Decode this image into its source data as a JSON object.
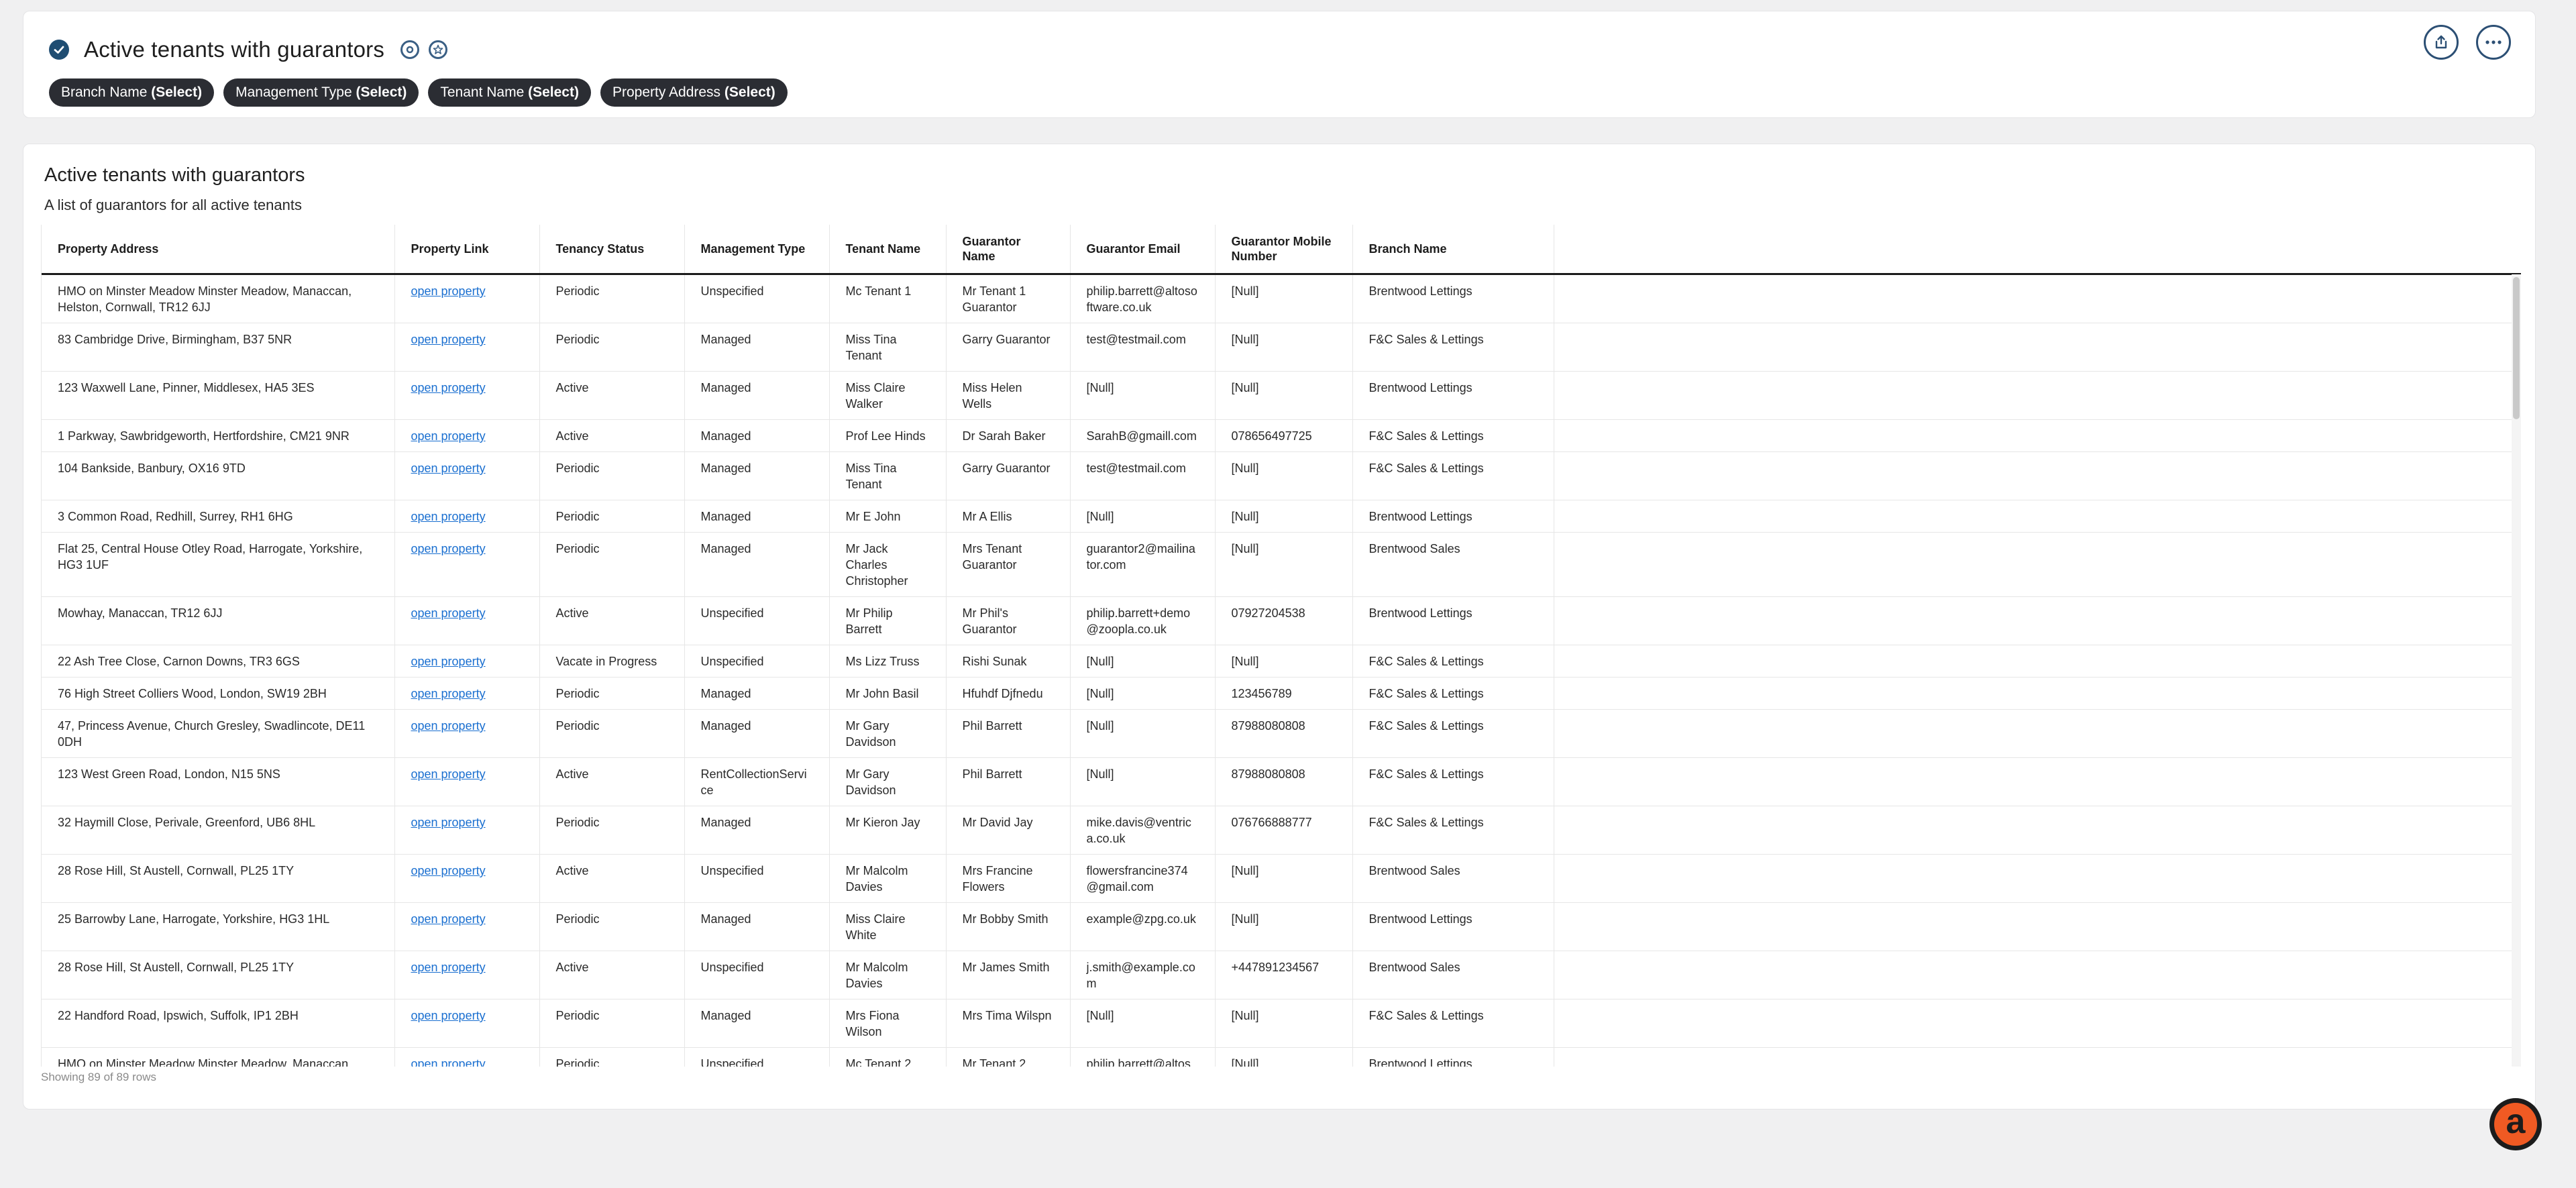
{
  "header": {
    "title": "Active tenants with guarantors",
    "icons": [
      "verified-check-icon",
      "settings-circle-icon",
      "star-circle-icon"
    ],
    "actions": [
      {
        "name": "share-button",
        "icon": "share-icon"
      },
      {
        "name": "more-options-button",
        "icon": "ellipsis-icon"
      }
    ]
  },
  "filters": [
    {
      "label": "Branch Name",
      "value": "(Select)"
    },
    {
      "label": "Management Type",
      "value": "(Select)"
    },
    {
      "label": "Tenant Name",
      "value": "(Select)"
    },
    {
      "label": "Property Address",
      "value": "(Select)"
    }
  ],
  "table": {
    "title": "Active tenants with guarantors",
    "subtitle": "A list of guarantors for all active tenants",
    "columns": [
      "Property Address",
      "Property Link",
      "Tenancy Status",
      "Management Type",
      "Tenant Name",
      "Guarantor Name",
      "Guarantor Email",
      "Guarantor Mobile Number",
      "Branch Name"
    ],
    "rows": [
      [
        "HMO on Minster Meadow Minster Meadow, Manaccan, Helston, Cornwall, TR12 6JJ",
        "open property",
        "Periodic",
        "Unspecified",
        "Mc Tenant 1",
        "Mr Tenant 1 Guarantor",
        "philip.barrett@altosoftware.co.uk",
        "[Null]",
        "Brentwood Lettings"
      ],
      [
        "83 Cambridge Drive, Birmingham, B37 5NR",
        "open property",
        "Periodic",
        "Managed",
        "Miss Tina Tenant",
        "Garry Guarantor",
        "test@testmail.com",
        "[Null]",
        "F&C Sales & Lettings"
      ],
      [
        "123 Waxwell Lane, Pinner, Middlesex, HA5 3ES",
        "open property",
        "Active",
        "Managed",
        "Miss Claire Walker",
        "Miss Helen Wells",
        "[Null]",
        "[Null]",
        "Brentwood Lettings"
      ],
      [
        "1 Parkway, Sawbridgeworth, Hertfordshire, CM21 9NR",
        "open property",
        "Active",
        "Managed",
        "Prof Lee Hinds",
        "Dr Sarah Baker",
        "SarahB@gmaill.com",
        "078656497725",
        "F&C Sales & Lettings"
      ],
      [
        "104 Bankside, Banbury, OX16 9TD",
        "open property",
        "Periodic",
        "Managed",
        "Miss Tina Tenant",
        "Garry Guarantor",
        "test@testmail.com",
        "[Null]",
        "F&C Sales & Lettings"
      ],
      [
        "3 Common Road, Redhill, Surrey, RH1 6HG",
        "open property",
        "Periodic",
        "Managed",
        "Mr E John",
        "Mr A Ellis",
        "[Null]",
        "[Null]",
        "Brentwood Lettings"
      ],
      [
        "Flat 25, Central House Otley Road, Harrogate, Yorkshire, HG3 1UF",
        "open property",
        "Periodic",
        "Managed",
        "Mr Jack Charles Christopher",
        "Mrs Tenant Guarantor",
        "guarantor2@mailinator.com",
        "[Null]",
        "Brentwood Sales"
      ],
      [
        "Mowhay, Manaccan, TR12 6JJ",
        "open property",
        "Active",
        "Unspecified",
        "Mr Philip Barrett",
        "Mr Phil's Guarantor",
        "philip.barrett+demo@zoopla.co.uk",
        "07927204538",
        "Brentwood Lettings"
      ],
      [
        "22 Ash Tree Close, Carnon Downs, TR3 6GS",
        "open property",
        "Vacate in Progress",
        "Unspecified",
        "Ms Lizz Truss",
        "Rishi Sunak",
        "[Null]",
        "[Null]",
        "F&C Sales & Lettings"
      ],
      [
        "76 High Street Colliers Wood, London, SW19 2BH",
        "open property",
        "Periodic",
        "Managed",
        "Mr John Basil",
        "Hfuhdf Djfnedu",
        "[Null]",
        "123456789",
        "F&C Sales & Lettings"
      ],
      [
        "47, Princess Avenue, Church Gresley, Swadlincote, DE11 0DH",
        "open property",
        "Periodic",
        "Managed",
        "Mr Gary Davidson",
        "Phil Barrett",
        "[Null]",
        "87988080808",
        "F&C Sales & Lettings"
      ],
      [
        "123 West Green Road, London, N15 5NS",
        "open property",
        "Active",
        "RentCollectionService",
        "Mr Gary Davidson",
        "Phil Barrett",
        "[Null]",
        "87988080808",
        "F&C Sales & Lettings"
      ],
      [
        "32 Haymill Close, Perivale, Greenford, UB6 8HL",
        "open property",
        "Periodic",
        "Managed",
        "Mr Kieron Jay",
        "Mr David Jay",
        "mike.davis@ventrica.co.uk",
        "076766888777",
        "F&C Sales & Lettings"
      ],
      [
        "28 Rose Hill, St Austell, Cornwall, PL25 1TY",
        "open property",
        "Active",
        "Unspecified",
        "Mr Malcolm Davies",
        "Mrs Francine Flowers",
        "flowersfrancine374@gmail.com",
        "[Null]",
        "Brentwood Sales"
      ],
      [
        "25 Barrowby Lane, Harrogate, Yorkshire, HG3 1HL",
        "open property",
        "Periodic",
        "Managed",
        "Miss Claire White",
        "Mr Bobby Smith",
        "example@zpg.co.uk",
        "[Null]",
        "Brentwood Lettings"
      ],
      [
        "28 Rose Hill, St Austell, Cornwall, PL25 1TY",
        "open property",
        "Active",
        "Unspecified",
        "Mr Malcolm Davies",
        "Mr James Smith",
        "j.smith@example.com",
        "+447891234567",
        "Brentwood Sales"
      ],
      [
        "22 Handford Road, Ipswich, Suffolk, IP1 2BH",
        "open property",
        "Periodic",
        "Managed",
        "Mrs Fiona Wilson",
        "Mrs Tima Wilspn",
        "[Null]",
        "[Null]",
        "F&C Sales & Lettings"
      ],
      [
        "HMO on Minster Meadow Minster Meadow, Manaccan",
        "open property",
        "Periodic",
        "Unspecified",
        "Mc Tenant 2",
        "Mr Tenant 2",
        "philip.barrett@altos",
        "[Null]",
        "Brentwood Lettings"
      ]
    ],
    "row_count_text": "Showing 89 of 89 rows"
  },
  "fab": {
    "letter": "a",
    "icon": "assistant-logo-icon"
  }
}
